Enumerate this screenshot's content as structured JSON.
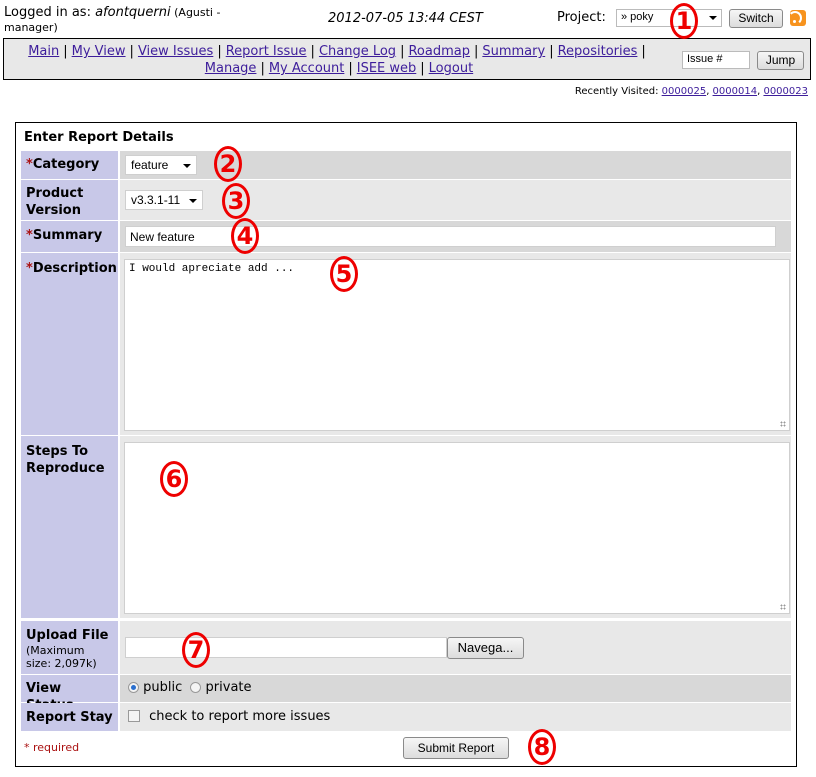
{
  "header": {
    "logged_in_prefix": "Logged in as: ",
    "username": "afontquerni",
    "role": " (Agusti - manager)",
    "datetime": "2012-07-05 13:44 CEST",
    "project_label": "Project:",
    "project_selected": "» poky",
    "switch_label": "Switch",
    "rss_icon": "rss-feed-icon"
  },
  "menu": {
    "links": [
      "Main",
      "My View",
      "View Issues",
      "Report Issue",
      "Change Log",
      "Roadmap",
      "Summary",
      "Repositories",
      "Manage",
      "My Account",
      "ISEE web",
      "Logout"
    ],
    "issue_placeholder": "Issue #",
    "jump_label": "Jump"
  },
  "recently_visited": {
    "label": "Recently Visited: ",
    "issues": [
      "0000025",
      "0000014",
      "0000023"
    ]
  },
  "form": {
    "title": "Enter Report Details",
    "required_marker": "*",
    "category": {
      "label": "Category",
      "value": "feature"
    },
    "product_version": {
      "label": "Product Version",
      "value": "v3.3.1-11"
    },
    "summary": {
      "label": "Summary",
      "value": "New feature"
    },
    "description": {
      "label": "Description",
      "value": "I would apreciate add ..."
    },
    "steps": {
      "label": "Steps To Reproduce",
      "value": ""
    },
    "upload": {
      "label": "Upload File",
      "note": "(Maximum size: 2,097k)",
      "value": "",
      "browse_label": "Navega..."
    },
    "view_status": {
      "label": "View Status",
      "options": [
        "public",
        "private"
      ],
      "selected": "public"
    },
    "report_stay": {
      "label": "Report Stay",
      "checkbox_label": "check to report more issues",
      "checked": false
    },
    "required_note": "* required",
    "submit_label": "Submit Report"
  },
  "annotations": [
    "1",
    "2",
    "3",
    "4",
    "5",
    "6",
    "7",
    "8"
  ],
  "colors": {
    "label_bg": "#c8c8e8",
    "row_dark": "#d8d8d8",
    "row_light": "#e8e8e8",
    "link": "#3d1d9b",
    "required": "#aa1111",
    "annotation": "#ee0000"
  }
}
